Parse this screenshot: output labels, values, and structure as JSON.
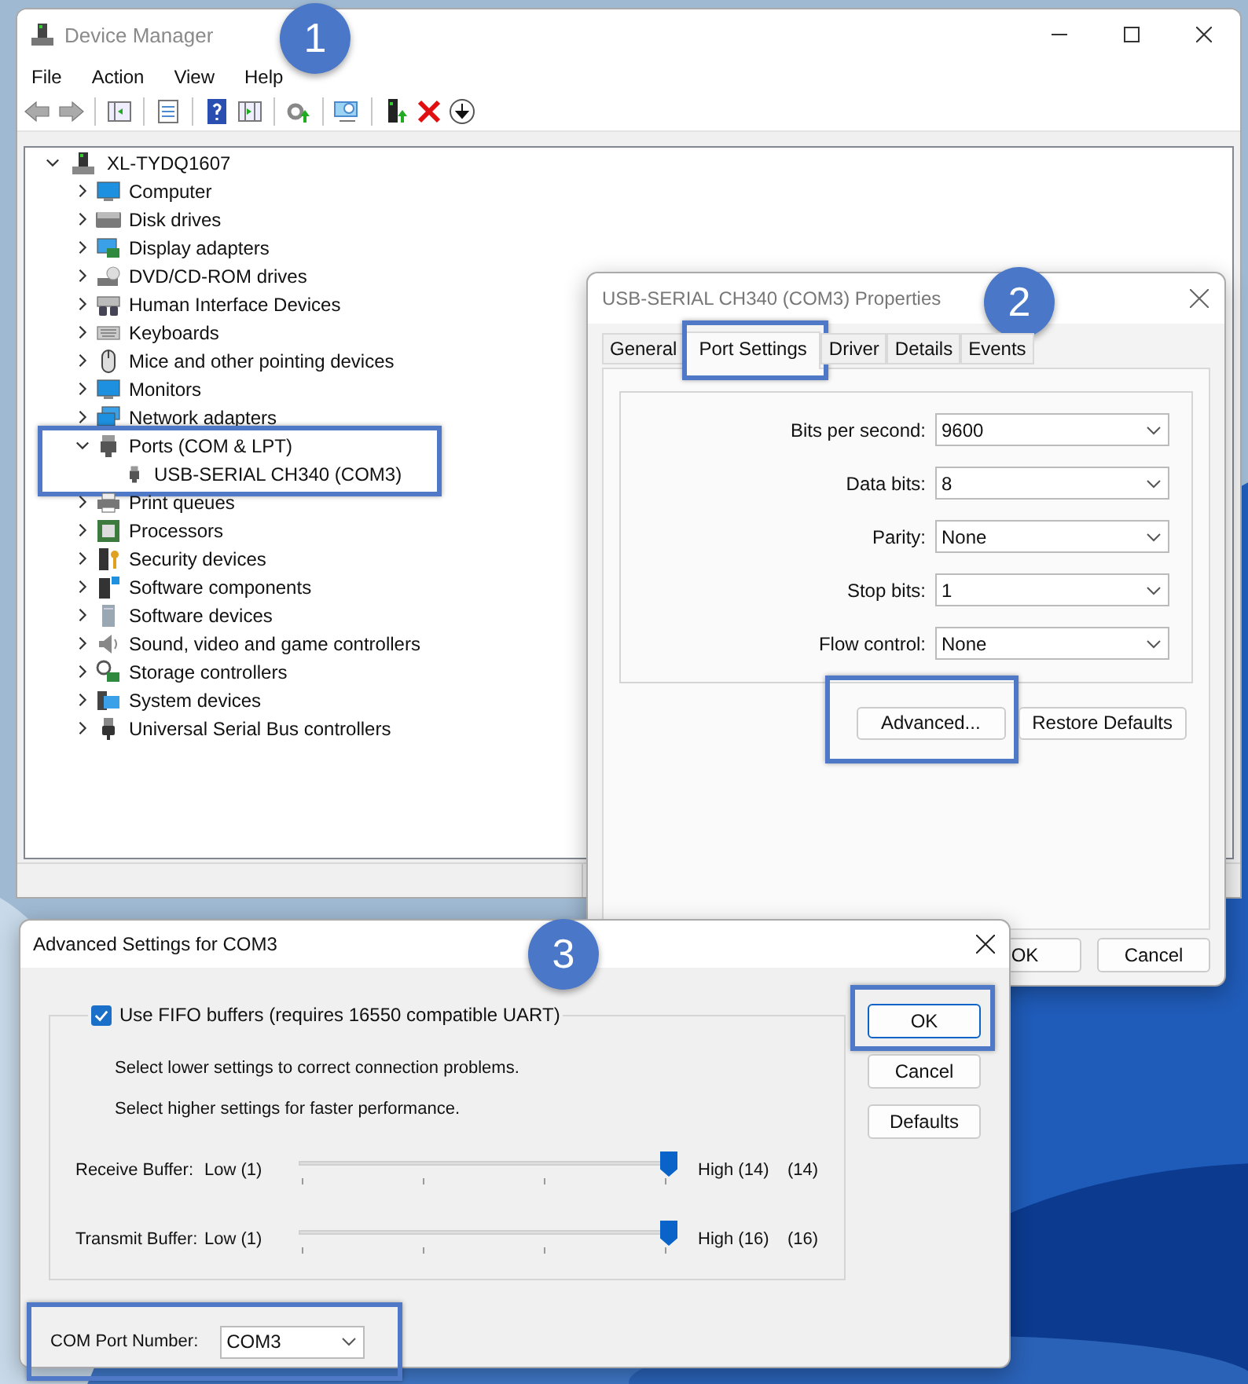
{
  "device_manager": {
    "title": "Device Manager",
    "menu": [
      "File",
      "Action",
      "View",
      "Help"
    ],
    "tree": {
      "label": "XL-TYDQ1607",
      "expanded": true,
      "children": [
        {
          "label": "Computer",
          "expanded": false,
          "highlighted": false
        },
        {
          "label": "Disk drives",
          "expanded": false,
          "highlighted": false
        },
        {
          "label": "Display adapters",
          "expanded": false,
          "highlighted": false
        },
        {
          "label": "DVD/CD-ROM drives",
          "expanded": false,
          "highlighted": false
        },
        {
          "label": "Human Interface Devices",
          "expanded": false,
          "highlighted": false
        },
        {
          "label": "Keyboards",
          "expanded": false,
          "highlighted": false
        },
        {
          "label": "Mice and other pointing devices",
          "expanded": false,
          "highlighted": false
        },
        {
          "label": "Monitors",
          "expanded": false,
          "highlighted": false
        },
        {
          "label": "Network adapters",
          "expanded": false,
          "highlighted": false
        },
        {
          "label": "Ports (COM & LPT)",
          "expanded": true,
          "highlighted": true,
          "children": [
            {
              "label": "USB-SERIAL CH340 (COM3)"
            }
          ]
        },
        {
          "label": "Print queues",
          "expanded": false,
          "highlighted": false
        },
        {
          "label": "Processors",
          "expanded": false,
          "highlighted": false
        },
        {
          "label": "Security devices",
          "expanded": false,
          "highlighted": false
        },
        {
          "label": "Software components",
          "expanded": false,
          "highlighted": false
        },
        {
          "label": "Software devices",
          "expanded": false,
          "highlighted": false
        },
        {
          "label": "Sound, video and game controllers",
          "expanded": false,
          "highlighted": false
        },
        {
          "label": "Storage controllers",
          "expanded": false,
          "highlighted": false
        },
        {
          "label": "System devices",
          "expanded": false,
          "highlighted": false
        },
        {
          "label": "Universal Serial Bus controllers",
          "expanded": false,
          "highlighted": false
        }
      ]
    }
  },
  "properties_dialog": {
    "title": "USB-SERIAL CH340 (COM3) Properties",
    "tabs": [
      {
        "label": "General",
        "selected": false,
        "highlighted": false
      },
      {
        "label": "Port Settings",
        "selected": true,
        "highlighted": true
      },
      {
        "label": "Driver",
        "selected": false,
        "highlighted": false
      },
      {
        "label": "Details",
        "selected": false,
        "highlighted": false
      },
      {
        "label": "Events",
        "selected": false,
        "highlighted": false
      }
    ],
    "fields": [
      {
        "label": "Bits per second:",
        "value": "9600"
      },
      {
        "label": "Data bits:",
        "value": "8"
      },
      {
        "label": "Parity:",
        "value": "None"
      },
      {
        "label": "Stop bits:",
        "value": "1"
      },
      {
        "label": "Flow control:",
        "value": "None"
      }
    ],
    "actions": [
      {
        "label": "Advanced...",
        "highlighted": true
      },
      {
        "label": "Restore Defaults",
        "highlighted": false
      }
    ],
    "footer_buttons": [
      "OK",
      "Cancel"
    ]
  },
  "advanced_dialog": {
    "title": "Advanced Settings for COM3",
    "fifo": {
      "label": "Use FIFO buffers (requires 16550 compatible UART)",
      "checked": true
    },
    "hints": [
      "Select lower settings to correct connection problems.",
      "Select higher settings for faster performance."
    ],
    "sliders": [
      {
        "label": "Receive Buffer:",
        "low": "Low (1)",
        "high": "High (14)",
        "reading": "(14)",
        "level": 1
      },
      {
        "label": "Transmit Buffer:",
        "low": "Low (1)",
        "high": "High (16)",
        "reading": "(16)",
        "level": 1
      }
    ],
    "com_port": {
      "label": "COM Port Number:",
      "value": "COM3",
      "highlighted": true
    },
    "buttons": [
      {
        "label": "OK",
        "highlighted": true
      },
      {
        "label": "Cancel",
        "highlighted": false
      },
      {
        "label": "Defaults",
        "highlighted": false
      }
    ]
  },
  "badges": [
    "1",
    "2",
    "3"
  ]
}
